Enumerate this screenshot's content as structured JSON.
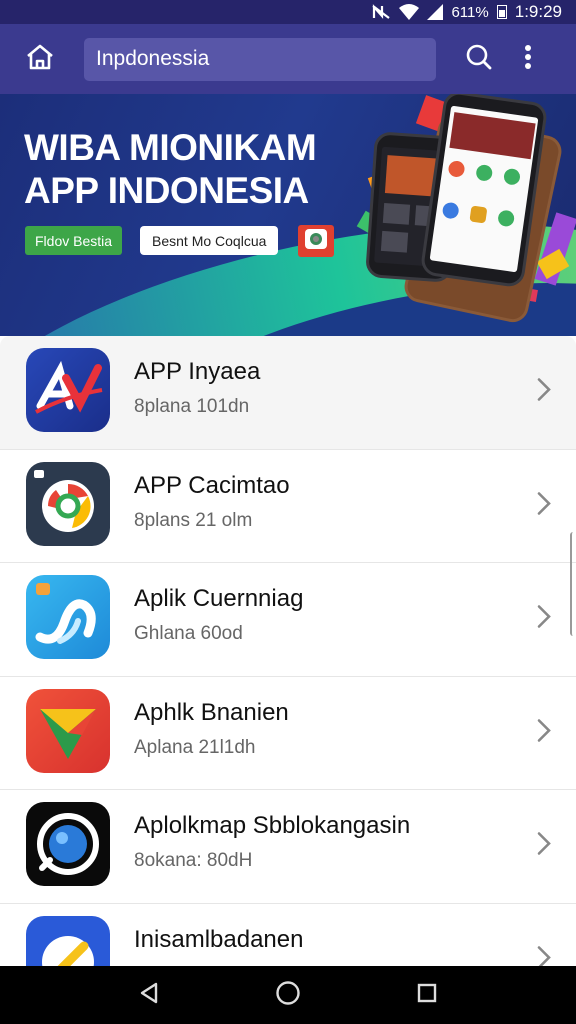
{
  "status_bar": {
    "battery": "611%",
    "time": "1:9:29",
    "icons": [
      "nfc-icon",
      "wifi-icon",
      "signal-icon",
      "battery-icon"
    ]
  },
  "app_bar": {
    "search_value": "Inpdonessia",
    "icons": [
      "home-icon",
      "search-icon",
      "more-vert-icon"
    ]
  },
  "banner": {
    "title_line1": "WIBA MIONIKAM",
    "title_line2": "APP INDONESIA",
    "green_button": "Fldov Bestia",
    "white_button": "Besnt Mo Coqlcua"
  },
  "apps": [
    {
      "title": "APP Inyaea",
      "subtitle": "8plana 101dn",
      "icon": "apv-logo-icon"
    },
    {
      "title": "APP Cacimtao",
      "subtitle": "8plans 21 olm",
      "icon": "chrome-like-icon"
    },
    {
      "title": "Aplik Cuernniag",
      "subtitle": "Ghlana  60od",
      "icon": "ribbon-app-icon"
    },
    {
      "title": "Aphlk Bnanien",
      "subtitle": "Aplana 21l1dh",
      "icon": "play-store-like-icon"
    },
    {
      "title": "Aplolkmap Sbblokangasin",
      "subtitle": "8okana: 80dH",
      "icon": "lens-app-icon"
    },
    {
      "title": "Inisamlbadanen",
      "subtitle": "",
      "icon": "compass-app-icon"
    }
  ],
  "colors": {
    "status_bar": "#26246a",
    "app_bar": "#3b3a8f",
    "search_field": "#5856a8",
    "banner": "#1c2e7a",
    "green_button": "#3da648",
    "nav_bar": "#000000"
  },
  "nav_bar": {
    "icons": [
      "back-icon",
      "home-circle-icon",
      "recents-icon"
    ]
  }
}
